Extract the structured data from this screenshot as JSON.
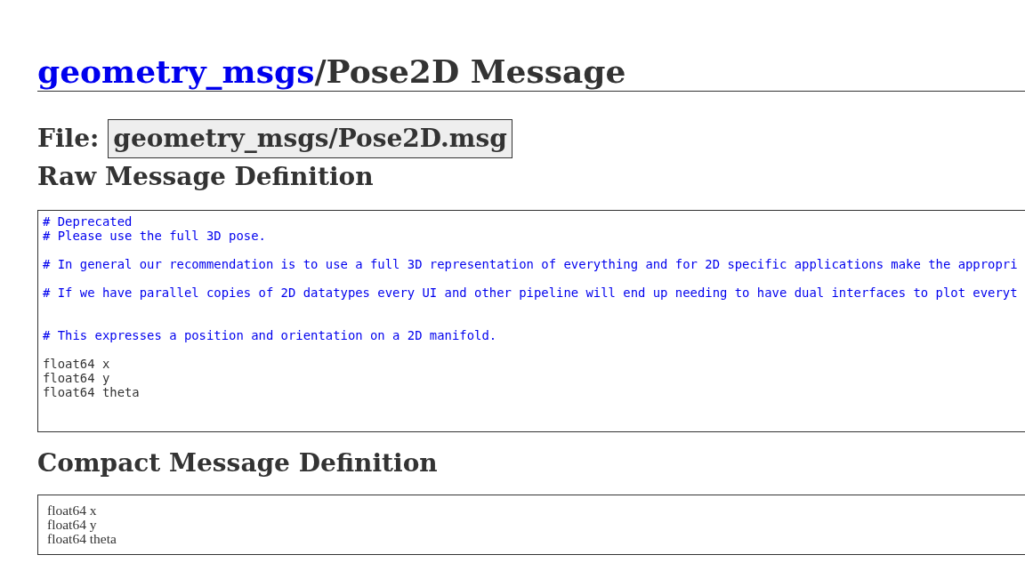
{
  "title": {
    "package_link": "geometry_msgs",
    "rest": "/Pose2D Message"
  },
  "file": {
    "label": "File:",
    "name": "geometry_msgs/Pose2D.msg"
  },
  "raw_definition": {
    "heading": "Raw Message Definition",
    "lines": [
      {
        "kind": "comment",
        "text": "# Deprecated"
      },
      {
        "kind": "comment",
        "text": "# Please use the full 3D pose."
      },
      {
        "kind": "blank"
      },
      {
        "kind": "comment",
        "text": "# In general our recommendation is to use a full 3D representation of everything and for 2D specific applications make the appropri"
      },
      {
        "kind": "blank"
      },
      {
        "kind": "comment",
        "text": "# If we have parallel copies of 2D datatypes every UI and other pipeline will end up needing to have dual interfaces to plot everyt"
      },
      {
        "kind": "blank"
      },
      {
        "kind": "blank"
      },
      {
        "kind": "comment",
        "text": "# This expresses a position and orientation on a 2D manifold."
      },
      {
        "kind": "blank"
      },
      {
        "kind": "code",
        "text": "float64 x"
      },
      {
        "kind": "code",
        "text": "float64 y"
      },
      {
        "kind": "code",
        "text": "float64 theta"
      },
      {
        "kind": "blank"
      },
      {
        "kind": "blank"
      }
    ]
  },
  "compact_definition": {
    "heading": "Compact Message Definition",
    "lines": [
      "float64 x",
      "float64 y",
      "float64 theta"
    ]
  }
}
